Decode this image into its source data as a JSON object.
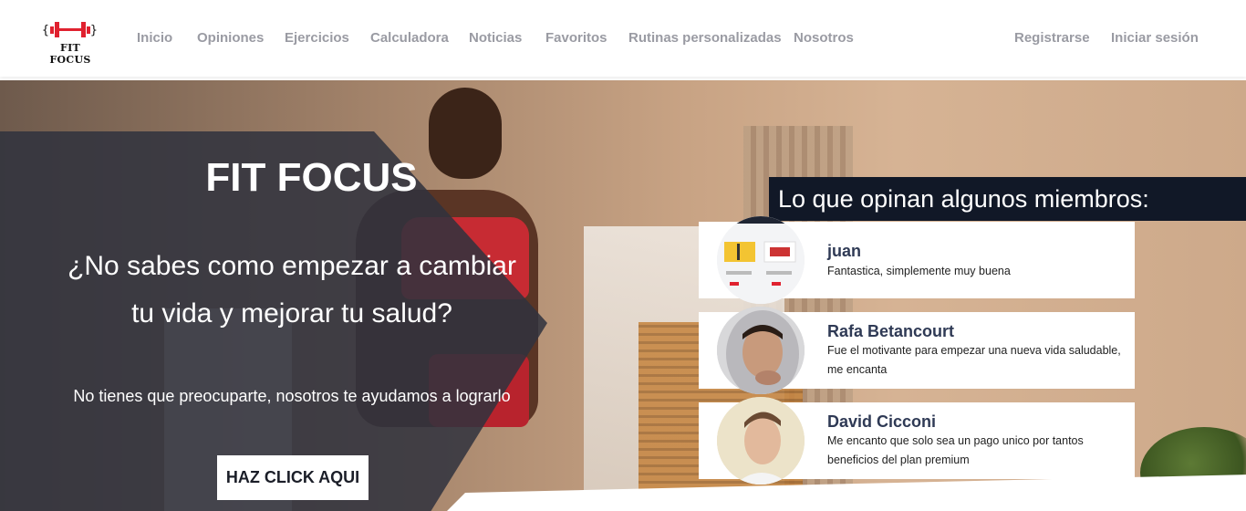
{
  "brand": {
    "name": "FIT FOCUS",
    "accent": "#e0212f"
  },
  "nav": {
    "links": [
      "Inicio",
      "Opiniones",
      "Ejercicios",
      "Calculadora",
      "Noticias",
      "Favoritos",
      "Rutinas personalizadas",
      "Nosotros"
    ],
    "register": "Registrarse",
    "login": "Iniciar sesión"
  },
  "hero": {
    "title": "FIT FOCUS",
    "question_line1": "¿No sabes como empezar a cambiar",
    "question_line2": "tu vida y mejorar tu salud?",
    "subtitle": "No tienes que preocuparte, nosotros te ayudamos a lograrlo",
    "cta": "HAZ CLICK AQUI"
  },
  "opinions": {
    "title": "Lo que opinan algunos miembros:",
    "items": [
      {
        "name": "juan",
        "text": "Fantastica, simplemente muy buena"
      },
      {
        "name": "Rafa Betancourt",
        "text": "Fue el motivante para empezar una nueva vida saludable, me encanta"
      },
      {
        "name": "David Cicconi",
        "text": "Me encanto que solo sea un pago unico por tantos beneficios del plan premium"
      }
    ]
  }
}
